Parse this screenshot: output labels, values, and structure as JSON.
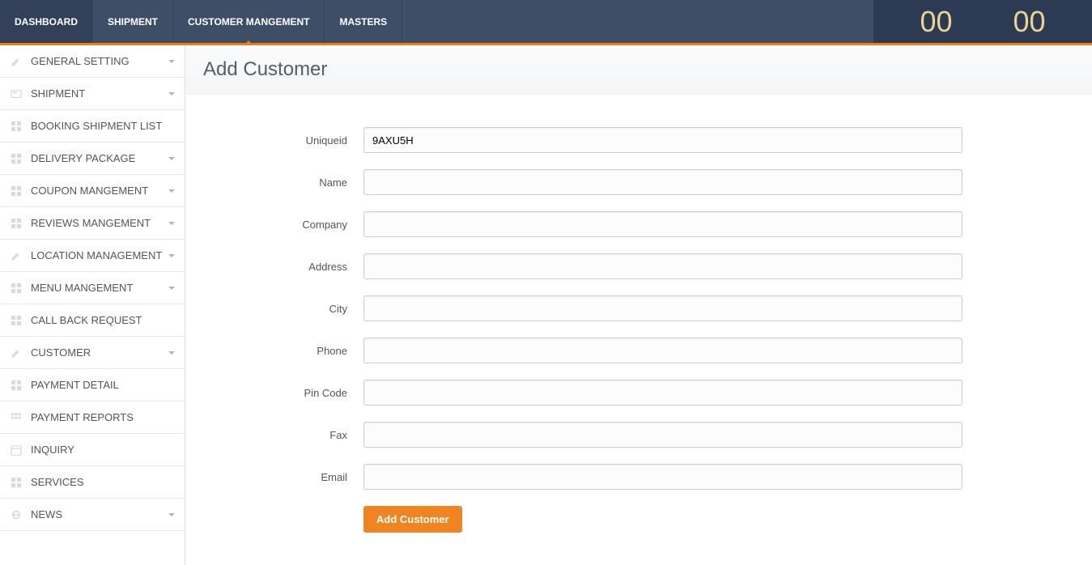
{
  "topnav": {
    "items": [
      {
        "label": "DASHBOARD"
      },
      {
        "label": "SHIPMENT"
      },
      {
        "label": "CUSTOMER MANGEMENT",
        "active": true
      },
      {
        "label": "MASTERS"
      }
    ]
  },
  "counters": {
    "left": "00",
    "right": "00"
  },
  "sidebar": {
    "items": [
      {
        "label": "GENERAL SETTING",
        "icon": "pencil",
        "expandable": true
      },
      {
        "label": "SHIPMENT",
        "icon": "card",
        "expandable": true
      },
      {
        "label": "BOOKING SHIPMENT LIST",
        "icon": "grid",
        "expandable": false
      },
      {
        "label": "DELIVERY PACKAGE",
        "icon": "grid",
        "expandable": true
      },
      {
        "label": "COUPON MANGEMENT",
        "icon": "grid",
        "expandable": true
      },
      {
        "label": "REVIEWS MANGEMENT",
        "icon": "grid",
        "expandable": true
      },
      {
        "label": "LOCATION MANAGEMENT",
        "icon": "pencil",
        "expandable": true
      },
      {
        "label": "MENU MANGEMENT",
        "icon": "grid",
        "expandable": true
      },
      {
        "label": "CALL BACK REQUEST",
        "icon": "grid",
        "expandable": false
      },
      {
        "label": "CUSTOMER",
        "icon": "pencil",
        "expandable": true
      },
      {
        "label": "PAYMENT DETAIL",
        "icon": "grid",
        "expandable": false
      },
      {
        "label": "PAYMENT REPORTS",
        "icon": "dots",
        "expandable": false
      },
      {
        "label": "INQUIRY",
        "icon": "calendar",
        "expandable": false
      },
      {
        "label": "SERVICES",
        "icon": "grid",
        "expandable": false
      },
      {
        "label": "NEWS",
        "icon": "circle",
        "expandable": true
      }
    ]
  },
  "page": {
    "title": "Add Customer"
  },
  "form": {
    "fields": [
      {
        "label": "Uniqueid",
        "value": "9AXU5H",
        "name": "uniqueid"
      },
      {
        "label": "Name",
        "value": "",
        "name": "name"
      },
      {
        "label": "Company",
        "value": "",
        "name": "company"
      },
      {
        "label": "Address",
        "value": "",
        "name": "address"
      },
      {
        "label": "City",
        "value": "",
        "name": "city"
      },
      {
        "label": "Phone",
        "value": "",
        "name": "phone"
      },
      {
        "label": "Pin Code",
        "value": "",
        "name": "pincode"
      },
      {
        "label": "Fax",
        "value": "",
        "name": "fax"
      },
      {
        "label": "Email",
        "value": "",
        "name": "email"
      }
    ],
    "submit_label": "Add Customer"
  }
}
